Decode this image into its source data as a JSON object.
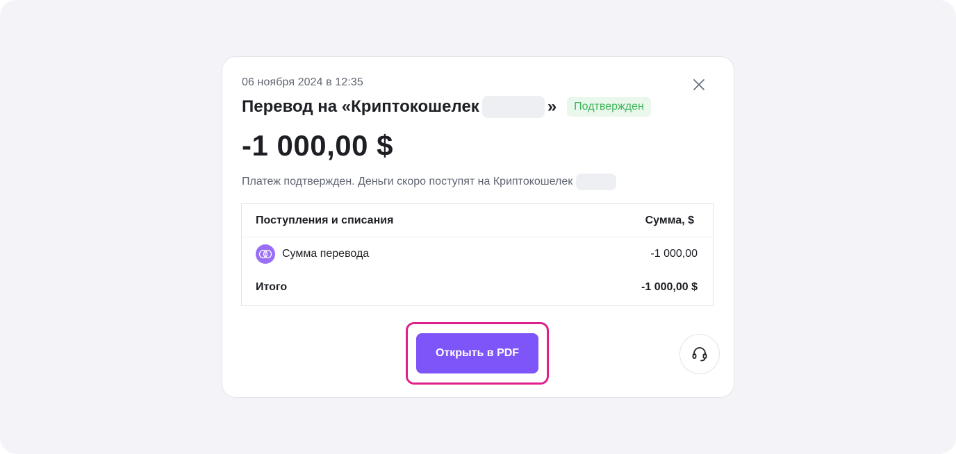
{
  "modal": {
    "date": "06 ноября 2024 в 12:35",
    "title_prefix": "Перевод на «Криптокошелек",
    "title_suffix": "»",
    "status_badge": "Подтвержден",
    "amount": "-1 000,00 $",
    "note": "Платеж подтвержден. Деньги скоро поступят на Криптокошелек",
    "close_icon": "close-icon",
    "support_icon": "headset-icon"
  },
  "table": {
    "header": {
      "left": "Поступления и списания",
      "right": "Сумма, $"
    },
    "rows": [
      {
        "label": "Сумма перевода",
        "value": "-1 000,00",
        "icon": "coin-transfer-icon"
      }
    ],
    "total": {
      "label": "Итого",
      "value": "-1 000,00 $"
    }
  },
  "actions": {
    "open_pdf_label": "Открыть в PDF"
  },
  "colors": {
    "accent": "#7d55f9",
    "highlight": "#e0208a",
    "success": "#3fb559",
    "success_bg": "#e9f7ec",
    "icon_bg": "#9a6ef5"
  }
}
